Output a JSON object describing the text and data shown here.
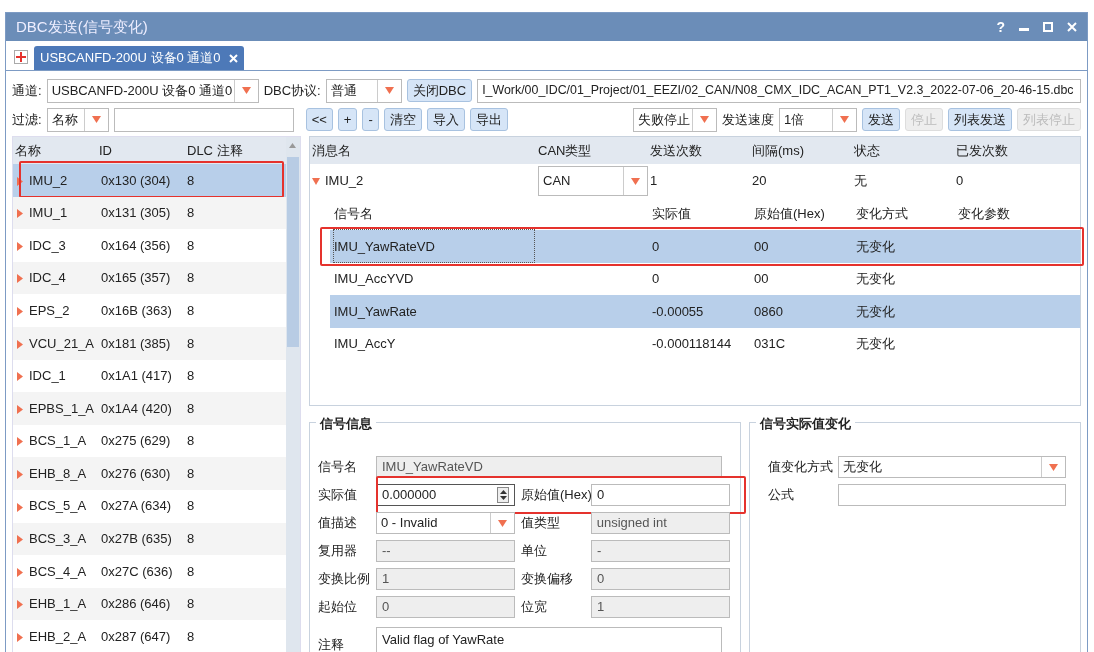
{
  "window": {
    "title": "DBC发送(信号变化)",
    "help": "?"
  },
  "tabs": [
    {
      "label": "USBCANFD-200U 设备0 通道0",
      "selected": true
    }
  ],
  "toolbar": {
    "channel_label": "通道:",
    "channel": "USBCANFD-200U 设备0 通道0",
    "protocol_label": "DBC协议:",
    "protocol": "普通",
    "close_dbc": "关闭DBC",
    "dbc_path": "I_Work/00_IDC/01_Project/01_EEZI/02_CAN/N08_CMX_IDC_ACAN_PT1_V2.3_2022-07-06_20-46-15.dbc",
    "filter_label": "过滤:",
    "filter_field": "名称",
    "edit_buttons": [
      "<<",
      "+",
      "-",
      "清空",
      "导入",
      "导出"
    ],
    "fail_mode": "失败停止",
    "speed_label": "发送速度",
    "speed": "1倍",
    "send_buttons": [
      {
        "label": "发送",
        "disabled": false
      },
      {
        "label": "停止",
        "disabled": true
      },
      {
        "label": "列表发送",
        "disabled": false
      },
      {
        "label": "列表停止",
        "disabled": true
      }
    ]
  },
  "messages": {
    "columns": [
      "名称",
      "ID",
      "DLC",
      "注释"
    ],
    "rows": [
      {
        "name": "IMU_2",
        "id": "0x130 (304)",
        "dlc": "8",
        "selected": true,
        "outlined": true
      },
      {
        "name": "IMU_1",
        "id": "0x131 (305)",
        "dlc": "8",
        "selected": false,
        "outlined": false
      },
      {
        "name": "IDC_3",
        "id": "0x164 (356)",
        "dlc": "8",
        "selected": false,
        "outlined": false
      },
      {
        "name": "IDC_4",
        "id": "0x165 (357)",
        "dlc": "8",
        "selected": false,
        "outlined": false
      },
      {
        "name": "EPS_2",
        "id": "0x16B (363)",
        "dlc": "8",
        "selected": false,
        "outlined": false
      },
      {
        "name": "VCU_21_A",
        "id": "0x181 (385)",
        "dlc": "8",
        "selected": false,
        "outlined": false
      },
      {
        "name": "IDC_1",
        "id": "0x1A1 (417)",
        "dlc": "8",
        "selected": false,
        "outlined": false
      },
      {
        "name": "EPBS_1_A",
        "id": "0x1A4 (420)",
        "dlc": "8",
        "selected": false,
        "outlined": false
      },
      {
        "name": "BCS_1_A",
        "id": "0x275 (629)",
        "dlc": "8",
        "selected": false,
        "outlined": false
      },
      {
        "name": "EHB_8_A",
        "id": "0x276 (630)",
        "dlc": "8",
        "selected": false,
        "outlined": false
      },
      {
        "name": "BCS_5_A",
        "id": "0x27A (634)",
        "dlc": "8",
        "selected": false,
        "outlined": false
      },
      {
        "name": "BCS_3_A",
        "id": "0x27B (635)",
        "dlc": "8",
        "selected": false,
        "outlined": false
      },
      {
        "name": "BCS_4_A",
        "id": "0x27C (636)",
        "dlc": "8",
        "selected": false,
        "outlined": false
      },
      {
        "name": "EHB_1_A",
        "id": "0x286 (646)",
        "dlc": "8",
        "selected": false,
        "outlined": false
      },
      {
        "name": "EHB_2_A",
        "id": "0x287 (647)",
        "dlc": "8",
        "selected": false,
        "outlined": false
      }
    ]
  },
  "send_table": {
    "columns": [
      "消息名",
      "CAN类型",
      "发送次数",
      "间隔(ms)",
      "状态",
      "已发次数"
    ],
    "message": {
      "name": "IMU_2",
      "expanded": true,
      "can_type": "CAN",
      "send_count": "1",
      "interval": "20",
      "status": "无",
      "sent": "0"
    },
    "signal_columns": [
      "信号名",
      "实际值",
      "原始值(Hex)",
      "变化方式",
      "变化参数"
    ],
    "signals": [
      {
        "name": "IMU_YawRateVD",
        "actual": "0",
        "raw": "00",
        "change": "无变化",
        "selected": true,
        "outlined": true
      },
      {
        "name": "IMU_AccYVD",
        "actual": "0",
        "raw": "00",
        "change": "无变化",
        "selected": false,
        "outlined": false
      },
      {
        "name": "IMU_YawRate",
        "actual": "-0.00055",
        "raw": "0860",
        "change": "无变化",
        "selected": true,
        "outlined": false
      },
      {
        "name": "IMU_AccY",
        "actual": "-0.000118144",
        "raw": "031C",
        "change": "无变化",
        "selected": false,
        "outlined": false
      }
    ]
  },
  "signal_info": {
    "title": "信号信息",
    "rows": [
      {
        "outlined": false,
        "fields": [
          {
            "label": "信号名",
            "value": "IMU_YawRateVD",
            "kind": "readonly"
          }
        ]
      },
      {
        "outlined": true,
        "fields": [
          {
            "label": "实际值",
            "value": "0.000000",
            "kind": "spin"
          },
          {
            "label": "原始值(Hex)",
            "value": "0",
            "kind": "text"
          }
        ]
      },
      {
        "outlined": false,
        "fields": [
          {
            "label": "值描述",
            "value": "0 - Invalid",
            "kind": "select"
          },
          {
            "label": "值类型",
            "value": "unsigned int",
            "kind": "readonly"
          }
        ]
      },
      {
        "outlined": false,
        "fields": [
          {
            "label": "复用器",
            "value": "--",
            "kind": "readonly"
          },
          {
            "label": "单位",
            "value": "-",
            "kind": "readonly"
          }
        ]
      },
      {
        "outlined": false,
        "fields": [
          {
            "label": "变换比例",
            "value": "1",
            "kind": "readonly"
          },
          {
            "label": "变换偏移",
            "value": "0",
            "kind": "readonly"
          }
        ]
      },
      {
        "outlined": false,
        "fields": [
          {
            "label": "起始位",
            "value": "0",
            "kind": "readonly"
          },
          {
            "label": "位宽",
            "value": "1",
            "kind": "readonly"
          }
        ]
      },
      {
        "outlined": false,
        "fields": [
          {
            "label": "注释",
            "value": "Valid flag of YawRate",
            "kind": "textarea"
          }
        ]
      }
    ]
  },
  "value_change": {
    "title": "信号实际值变化",
    "fields": [
      {
        "label": "值变化方式",
        "value": "无变化",
        "kind": "select"
      },
      {
        "label": "公式",
        "kind": "text"
      }
    ]
  }
}
